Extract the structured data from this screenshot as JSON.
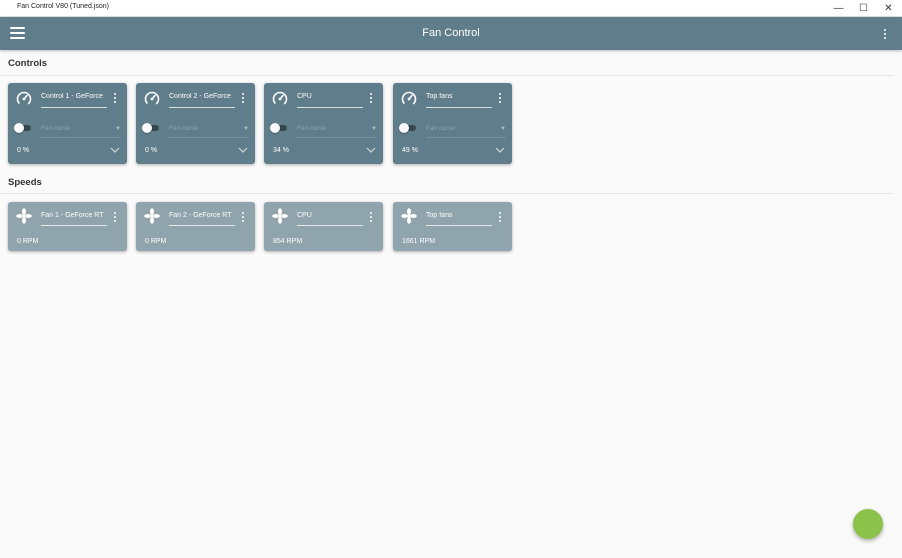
{
  "window": {
    "title": "Fan Control V80 (Tuned.json)",
    "minimize_glyph": "—",
    "maximize_glyph": "☐",
    "close_glyph": "✕"
  },
  "appbar": {
    "title": "Fan Control",
    "menu_icon": "hamburger-menu-icon",
    "overflow_icon": "more-vert-icon"
  },
  "controls": {
    "title": "Controls",
    "cards": [
      {
        "name": "Control 1 - GeForce",
        "curve_placeholder": "Fan curve",
        "percent": "0 %",
        "enabled": false
      },
      {
        "name": "Control 2 - GeForce",
        "curve_placeholder": "Fan curve",
        "percent": "0 %",
        "enabled": false
      },
      {
        "name": "CPU",
        "curve_placeholder": "Fan curve",
        "percent": "34 %",
        "enabled": false
      },
      {
        "name": "Top fans",
        "curve_placeholder": "Fan curve",
        "percent": "49 %",
        "enabled": false
      }
    ]
  },
  "speeds": {
    "title": "Speeds",
    "cards": [
      {
        "name": "Fan 1 - GeForce RT",
        "rpm": "0 RPM"
      },
      {
        "name": "Fan 2 - GeForce RT",
        "rpm": "0 RPM"
      },
      {
        "name": "CPU",
        "rpm": "854 RPM"
      },
      {
        "name": "Top fans",
        "rpm": "1661 RPM"
      }
    ]
  },
  "colors": {
    "accent": "#607d8b",
    "speed_card": "#90a4ae",
    "fab": "#8bc34a",
    "background": "#fafafa"
  }
}
